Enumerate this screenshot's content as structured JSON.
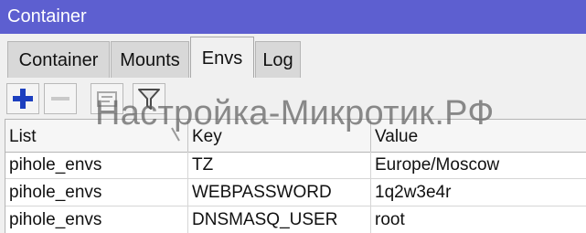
{
  "window": {
    "title": "Container"
  },
  "tabs": [
    {
      "label": "Container"
    },
    {
      "label": "Mounts"
    },
    {
      "label": "Envs"
    },
    {
      "label": "Log"
    }
  ],
  "toolbar": {
    "buttons": [
      "plus-icon",
      "minus-icon",
      "comment-icon",
      "filter-icon"
    ],
    "plus_color": "#1c3fbf"
  },
  "watermark": "Настройка-Микротик.РФ",
  "table": {
    "columns": [
      "List",
      "Key",
      "Value"
    ],
    "rows": [
      [
        "pihole_envs",
        "TZ",
        "Europe/Moscow"
      ],
      [
        "pihole_envs",
        "WEBPASSWORD",
        "1q2w3e4r"
      ],
      [
        "pihole_envs",
        "DNSMASQ_USER",
        "root"
      ]
    ]
  },
  "colors": {
    "titlebar": "#5d5fd0",
    "window_bg": "#f0f0f0"
  }
}
